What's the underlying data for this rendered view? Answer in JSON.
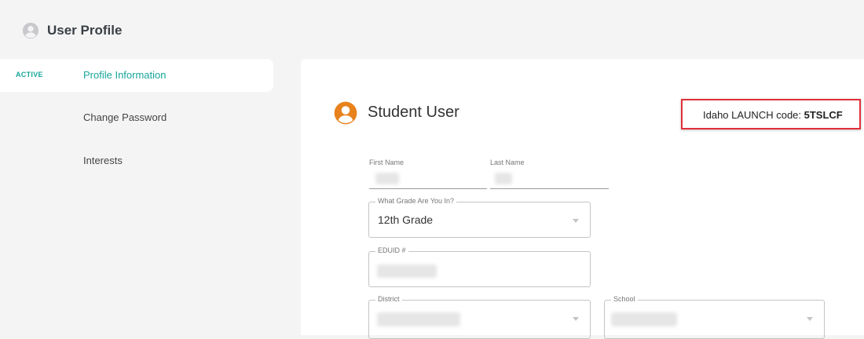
{
  "header": {
    "title": "User Profile",
    "icon": "user-circle-icon"
  },
  "sidebar": {
    "items": [
      {
        "badge": "ACTIVE",
        "label": "Profile Information",
        "active": true
      },
      {
        "badge": "",
        "label": "Change Password",
        "active": false
      },
      {
        "badge": "",
        "label": "Interests",
        "active": false
      }
    ]
  },
  "profile": {
    "name": "Student User",
    "avatar_icon": "user-circle-icon",
    "avatar_color": "#e8821c",
    "launch_label": "Idaho LAUNCH code: ",
    "launch_code": "5TSLCF"
  },
  "form": {
    "first_name_label": "First Name",
    "last_name_label": "Last Name",
    "grade_label": "What Grade Are You In?",
    "grade_value": "12th Grade",
    "eduid_label": "EDUID #",
    "district_label": "District",
    "school_label": "School"
  },
  "colors": {
    "accent": "#17a69b",
    "highlight_border": "#e0303a",
    "background": "#f4f4f5"
  }
}
